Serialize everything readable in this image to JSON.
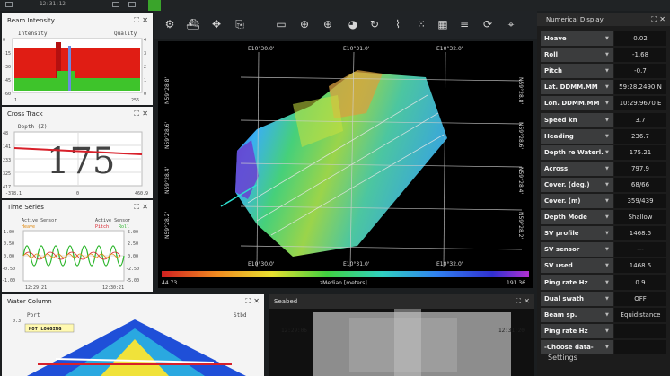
{
  "topbar": {
    "clock": "12:31:12"
  },
  "beam_intensity": {
    "title": "Beam Intensity",
    "label_left": "Intensity",
    "label_right": "Quality",
    "y_ticks": [
      "0",
      "-15",
      "-30",
      "-45",
      "-60"
    ],
    "right_ticks": [
      "4",
      "3",
      "2",
      "1",
      "0"
    ],
    "x_left": "1",
    "x_right": "256"
  },
  "cross_track": {
    "title": "Cross Track",
    "depth_label": "Depth (Z)",
    "big_value": "175",
    "y_ticks": [
      "48",
      "141",
      "233",
      "325",
      "417"
    ],
    "x_ticks": [
      "-378.1",
      "0",
      "460.9"
    ]
  },
  "time_series": {
    "title": "Time Series",
    "active_left": "Active Sensor",
    "active_right": "Active Sensor",
    "legend_heave": "Heave",
    "legend_pitch": "Pitch",
    "legend_roll": "Roll",
    "y_left": [
      "1.00",
      "0.50",
      "0.00",
      "-0.50",
      "-1.00"
    ],
    "y_right": [
      "5.00",
      "2.50",
      "0.00",
      "-2.50",
      "-5.00"
    ],
    "t_start": "12:29:21",
    "t_end": "12:30:21"
  },
  "water_column": {
    "title": "Water Column",
    "port": "Port",
    "stbd": "Stbd",
    "depth_top": "0.3",
    "status": "NOT LOGGING"
  },
  "seabed": {
    "title": "Seabed",
    "time_left": "12:29:06",
    "time_right": "12:31:20"
  },
  "map": {
    "top_lon": [
      "E10°30.0'",
      "E10°31.0'",
      "E10°32.0'"
    ],
    "bottom_lon": [
      "E10°30.0'",
      "E10°31.0'",
      "E10°32.0'"
    ],
    "left_lat": [
      "N59°28.8'",
      "N59°28.6'",
      "N59°28.4'",
      "N59°28.2'"
    ],
    "right_lat": [
      "N59°28.8'",
      "N59°28.6'",
      "N59°28.4'",
      "N59°28.2'"
    ],
    "colorbar_min": "44.73",
    "colorbar_label": "zMedian [meters]",
    "colorbar_max": "191.36"
  },
  "numerical_display": {
    "title": "Numerical Display",
    "rows": [
      {
        "label": "Heave",
        "value": "0.02"
      },
      {
        "label": "Roll",
        "value": "-1.68"
      },
      {
        "label": "Pitch",
        "value": "-0.7"
      },
      {
        "label": "Lat. DDMM.MM",
        "value": "59:28.2490 N"
      },
      {
        "label": "Lon. DDMM.MM",
        "value": "10:29.9670 E"
      },
      {
        "label": "Speed kn",
        "value": "3.7"
      },
      {
        "label": "Heading",
        "value": "236.7"
      },
      {
        "label": "Depth re Waterl.",
        "value": "175.21"
      },
      {
        "label": "Across",
        "value": "797.9"
      },
      {
        "label": "Cover. (deg.)",
        "value": "68/66"
      },
      {
        "label": "Cover. (m)",
        "value": "359/439"
      },
      {
        "label": "Depth Mode",
        "value": "Shallow"
      },
      {
        "label": "SV profile",
        "value": "1468.5"
      },
      {
        "label": "SV sensor",
        "value": "---"
      },
      {
        "label": "SV used",
        "value": "1468.5"
      },
      {
        "label": "Ping rate Hz",
        "value": "0.9"
      },
      {
        "label": "Dual swath",
        "value": "OFF"
      },
      {
        "label": "Beam sp.",
        "value": "Equidistance"
      },
      {
        "label": "Ping rate Hz",
        "value": ""
      },
      {
        "label": "-Choose data-",
        "value": ""
      }
    ],
    "settings": "Settings"
  },
  "accent": {
    "green": "#3aa42b",
    "panel_bg": "#f4f4f4",
    "dark_bg": "#1b1e20"
  }
}
